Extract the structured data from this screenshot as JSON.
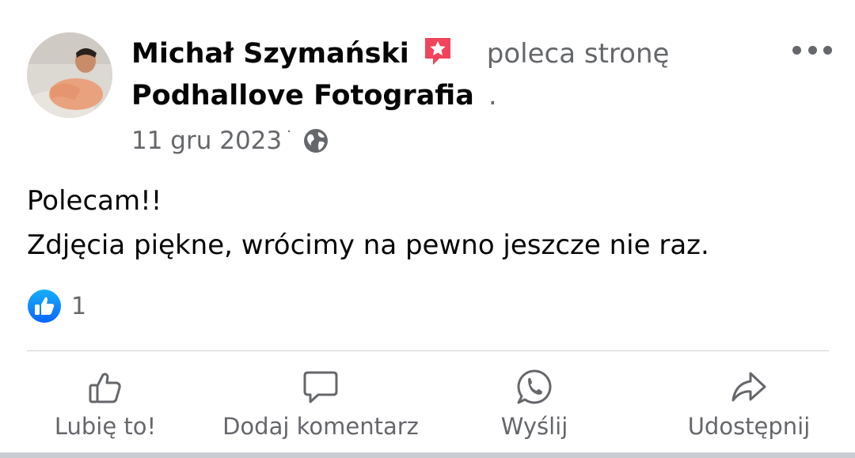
{
  "post": {
    "author": "Michał Szymański",
    "recommend_text": "poleca stronę",
    "page_name": "Podhallove Fotografia",
    "page_suffix": ".",
    "date": "11 gru 2023",
    "date_separator": "·",
    "lines": [
      "Polecam!!",
      "Zdjęcia piękne, wrócimy na pewno jeszcze nie raz."
    ],
    "reaction_count": "1"
  },
  "icons": {
    "recommend": "recommend-star-badge-icon",
    "more": "more-options-icon",
    "audience": "globe-icon",
    "reaction": "like-reaction-badge-icon"
  },
  "actions": [
    {
      "label": "Lubię to!",
      "icon": "thumbs-up-icon"
    },
    {
      "label": "Dodaj komentarz",
      "icon": "comment-bubble-icon"
    },
    {
      "label": "Wyślij",
      "icon": "whatsapp-icon"
    },
    {
      "label": "Udostępnij",
      "icon": "share-arrow-icon"
    }
  ],
  "colors": {
    "primary_text": "#050505",
    "secondary_text": "#65676b",
    "like_blue": "#1877f2",
    "recommend_red": "#f0455b",
    "divider": "#ced0d4"
  }
}
